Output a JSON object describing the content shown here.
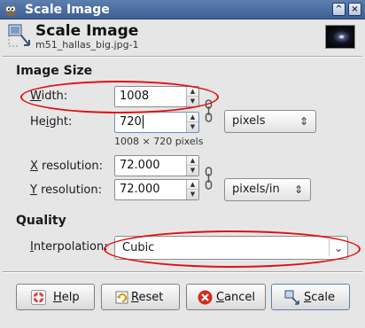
{
  "window": {
    "title": "Scale Image",
    "controls": {
      "shade": "^",
      "close": "×"
    }
  },
  "header": {
    "title": "Scale Image",
    "subtitle": "m51_hallas_big.jpg-1"
  },
  "image_size": {
    "section_title": "Image Size",
    "width": {
      "label_prefix": "",
      "label_mnemonic": "W",
      "label_rest": "idth:",
      "value": "1008"
    },
    "height": {
      "label_prefix": "He",
      "label_mnemonic": "i",
      "label_rest": "ght:",
      "value": "720"
    },
    "size_unit": "pixels",
    "size_info": "1008 × 720 pixels",
    "x_resolution": {
      "label_mnemonic": "X",
      "label_rest": " resolution:",
      "value": "72.000"
    },
    "y_resolution": {
      "label_mnemonic": "Y",
      "label_rest": " resolution:",
      "value": "72.000"
    },
    "resolution_unit": "pixels/in"
  },
  "quality": {
    "section_title": "Quality",
    "interpolation": {
      "label_mnemonic": "I",
      "label_rest": "nterpolation:",
      "value": "Cubic"
    }
  },
  "buttons": {
    "help": {
      "mnemonic": "H",
      "rest": "elp"
    },
    "reset": {
      "mnemonic": "R",
      "rest": "eset"
    },
    "cancel": {
      "mnemonic": "C",
      "rest": "ancel"
    },
    "scale": {
      "mnemonic": "S",
      "rest": "cale"
    }
  },
  "colors": {
    "annotation": "#e01010",
    "titlebar": "#4a6ea3"
  },
  "icons": {
    "window": "wilber-icon",
    "header": "scale-image-icon",
    "chain": "chain-link-icon",
    "help": "help-lifebuoy-icon",
    "reset": "reset-icon",
    "cancel": "cancel-icon",
    "scale": "scale-icon"
  }
}
